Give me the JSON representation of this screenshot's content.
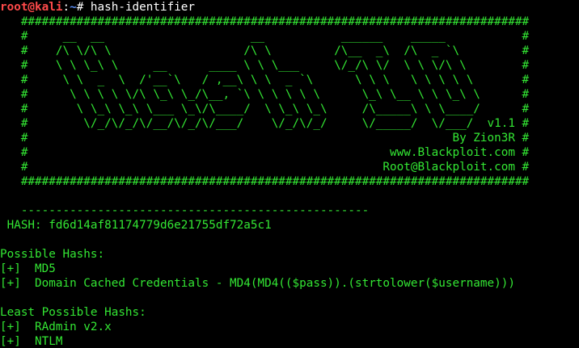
{
  "prompt": {
    "user_host": "root@kali",
    "separator": ":",
    "path": "~",
    "symbol": "# ",
    "command": "hash-identifier"
  },
  "banner": [
    "   #########################################################################",
    "   #     __  __                     __           ______    _____           #",
    "   #    /\\ \\/\\ \\                   /\\ \\         /\\__  _\\  /\\  _ `\\         #",
    "   #    \\ \\ \\_\\ \\     __      ____ \\ \\ \\___     \\/_/\\ \\/  \\ \\ \\/\\ \\        #",
    "   #     \\ \\  _  \\  /'__`\\   / ,__\\ \\ \\  _ `\\      \\ \\ \\   \\ \\ \\ \\ \\       #",
    "   #      \\ \\ \\ \\ \\/\\ \\_\\ \\_/\\__, `\\ \\ \\ \\ \\ \\      \\_\\ \\__ \\ \\ \\_\\ \\      #",
    "   #       \\ \\_\\ \\_\\ \\___ \\_\\/\\____/  \\ \\_\\ \\_\\     /\\_____\\ \\ \\____/      #",
    "   #        \\/_/\\/_/\\/__/\\/_/\\/___/    \\/_/\\/_/     \\/_____/  \\/___/  v1.1 #",
    "   #                                                             By Zion3R #",
    "   #                                                    www.Blackploit.com #",
    "   #                                                   Root@Blackploit.com #",
    "   #########################################################################"
  ],
  "separator_line": "   --------------------------------------------------",
  "hash_line": " HASH: fd6d14af81174779d6e21755df72a5c1",
  "possible_title": "Possible Hashs:",
  "possible": [
    "[+]  MD5",
    "[+]  Domain Cached Credentials - MD4(MD4(($pass)).(strtolower($username)))"
  ],
  "least_title": "Least Possible Hashs:",
  "least": [
    "[+]  RAdmin v2.x",
    "[+]  NTLM"
  ],
  "colors": {
    "background": "#000000",
    "text_green": "#33e633",
    "prompt_user": "#ff4a4a",
    "prompt_path": "#5b8ef6"
  }
}
